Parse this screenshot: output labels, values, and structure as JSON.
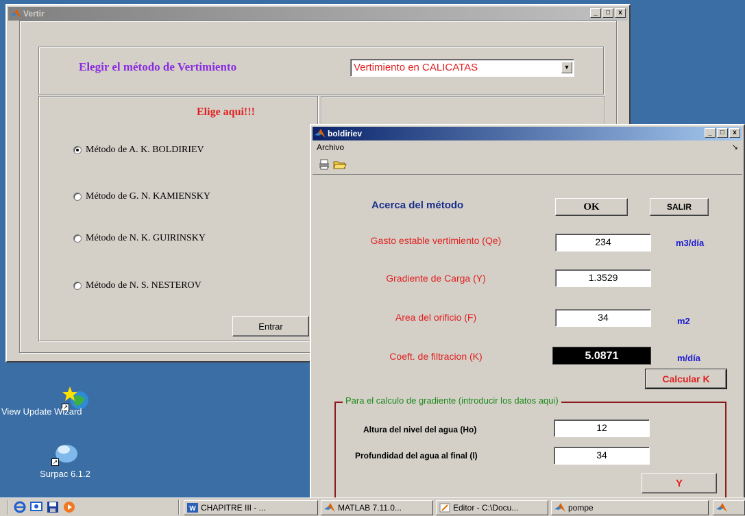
{
  "desktop": {
    "icons": [
      {
        "label": "View Update Wizard"
      },
      {
        "label": "Surpac 6.1.2"
      }
    ]
  },
  "vertir": {
    "title": "Vertir",
    "heading": "Elegir el método de Vertimiento",
    "select_value": "Vertimiento en CALICATAS",
    "elige": "Elige aqui!!!",
    "radios": [
      {
        "label": "Método de  A. K. BOLDIRIEV",
        "selected": true
      },
      {
        "label": "Método de G. N. KAMIENSKY",
        "selected": false
      },
      {
        "label": "Método de N. K. GUIRINSKY",
        "selected": false
      },
      {
        "label": "Método de N. S. NESTEROV",
        "selected": false
      }
    ],
    "enter_button": "Entrar"
  },
  "boldiriev": {
    "title": "boldiriev",
    "menu": {
      "archivo": "Archivo",
      "arrow": "↘"
    },
    "acerca": "Acerca del método",
    "ok_button": "OK",
    "salir_button": "SALIR",
    "gasto_label": "Gasto estable vertimiento (Qe)",
    "gasto_value": "234",
    "gasto_unit": "m3/día",
    "gradiente_label": "Gradiente de Carga (Y)",
    "gradiente_value": "1.3529",
    "area_label": "Area del orificio (F)",
    "area_value": "34",
    "area_unit": "m2",
    "coef_label": "Coeft. de filtracion (K)",
    "coef_value": "5.0871",
    "coef_unit": "m/día",
    "calcular_button": "Calcular K",
    "group_title": "Para el calculo de gradiente (introducir los datos aqui)",
    "altura_label": "Altura del nivel del agua (Ho)",
    "altura_value": "12",
    "profundidad_label": "Profundidad del agua al final (l)",
    "profundidad_value": "34",
    "y_button": "Y"
  },
  "taskbar": {
    "items": [
      {
        "label": "CHAPITRE III - ..."
      },
      {
        "label": "MATLAB  7.11.0..."
      },
      {
        "label": "Editor - C:\\Docu..."
      },
      {
        "label": "pompe"
      }
    ]
  },
  "colors": {
    "desktop": "#3a6ea5",
    "title_active": "#0a246a",
    "label_red": "#e02020",
    "unit_blue": "#1c1cd0",
    "heading_purple": "#8a2be2"
  }
}
